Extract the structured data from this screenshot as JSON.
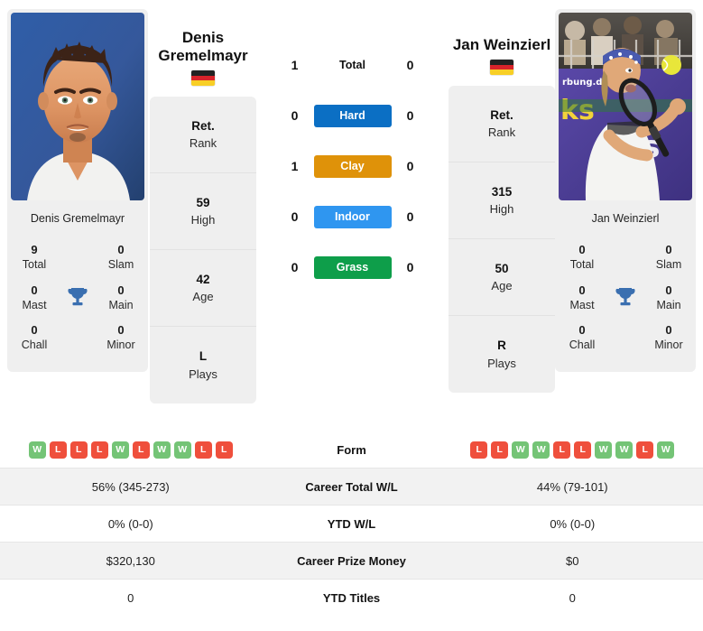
{
  "left_player": {
    "name": "Denis Gremelmayr",
    "display_name_line1": "Denis",
    "display_name_line2": "Gremelmayr",
    "country_code": "GER",
    "flag": "germany-flag",
    "photo_alt": "Denis Gremelmayr portrait",
    "achievements": [
      {
        "value": "9",
        "label": "Total"
      },
      {
        "value": "0",
        "label": "Slam"
      },
      {
        "value": "0",
        "label": "Mast"
      },
      {
        "value": "0",
        "label": "Main"
      },
      {
        "value": "0",
        "label": "Chall"
      },
      {
        "value": "0",
        "label": "Minor"
      }
    ],
    "stats": [
      {
        "value": "Ret.",
        "label": "Rank"
      },
      {
        "value": "59",
        "label": "High"
      },
      {
        "value": "42",
        "label": "Age"
      },
      {
        "value": "L",
        "label": "Plays"
      }
    ],
    "form": [
      "W",
      "L",
      "L",
      "L",
      "W",
      "L",
      "W",
      "W",
      "L",
      "L"
    ],
    "career_total_wl": "56% (345-273)",
    "ytd_wl": "0% (0-0)",
    "career_prize_money": "$320,130",
    "ytd_titles": "0"
  },
  "right_player": {
    "name": "Jan Weinzierl",
    "display_name_line1": "Jan Weinzierl",
    "display_name_line2": "",
    "country_code": "GER",
    "flag": "germany-flag",
    "photo_alt": "Jan Weinzierl hitting a backhand",
    "achievements": [
      {
        "value": "0",
        "label": "Total"
      },
      {
        "value": "0",
        "label": "Slam"
      },
      {
        "value": "0",
        "label": "Mast"
      },
      {
        "value": "0",
        "label": "Main"
      },
      {
        "value": "0",
        "label": "Chall"
      },
      {
        "value": "0",
        "label": "Minor"
      }
    ],
    "stats": [
      {
        "value": "Ret.",
        "label": "Rank"
      },
      {
        "value": "315",
        "label": "High"
      },
      {
        "value": "50",
        "label": "Age"
      },
      {
        "value": "R",
        "label": "Plays"
      }
    ],
    "form": [
      "L",
      "L",
      "W",
      "W",
      "L",
      "L",
      "W",
      "W",
      "L",
      "W"
    ],
    "career_total_wl": "44% (79-101)",
    "ytd_wl": "0% (0-0)",
    "career_prize_money": "$0",
    "ytd_titles": "0"
  },
  "head_to_head": [
    {
      "label": "Total",
      "left": "1",
      "right": "0",
      "color": "",
      "style": "plain"
    },
    {
      "label": "Hard",
      "left": "0",
      "right": "0",
      "color": "#0b6fc4",
      "style": "badge"
    },
    {
      "label": "Clay",
      "left": "1",
      "right": "0",
      "color": "#df9209",
      "style": "badge"
    },
    {
      "label": "Indoor",
      "left": "0",
      "right": "0",
      "color": "#2f96f0",
      "style": "badge"
    },
    {
      "label": "Grass",
      "left": "0",
      "right": "0",
      "color": "#0e9e4a",
      "style": "badge"
    }
  ],
  "table_rows": [
    {
      "label": "Form",
      "left": "",
      "right": "",
      "type": "form",
      "shaded": false
    },
    {
      "label": "Career Total W/L",
      "left": "56% (345-273)",
      "right": "44% (79-101)",
      "type": "text",
      "shaded": true
    },
    {
      "label": "YTD W/L",
      "left": "0% (0-0)",
      "right": "0% (0-0)",
      "type": "text",
      "shaded": false
    },
    {
      "label": "Career Prize Money",
      "left": "$320,130",
      "right": "$0",
      "type": "text",
      "shaded": true
    },
    {
      "label": "YTD Titles",
      "left": "0",
      "right": "0",
      "type": "text",
      "shaded": false
    }
  ],
  "colors": {
    "win": "#74c476",
    "loss": "#ef4f3c",
    "hard": "#0b6fc4",
    "clay": "#df9209",
    "indoor": "#2f96f0",
    "grass": "#0e9e4a",
    "trophy": "#3a6fb0",
    "panel": "#efefef",
    "row_shade": "#f2f2f2"
  },
  "flag_colors": {
    "germany": [
      "#222222",
      "#d8232a",
      "#f8cf26"
    ]
  },
  "icons": {
    "trophy": "trophy-icon"
  }
}
